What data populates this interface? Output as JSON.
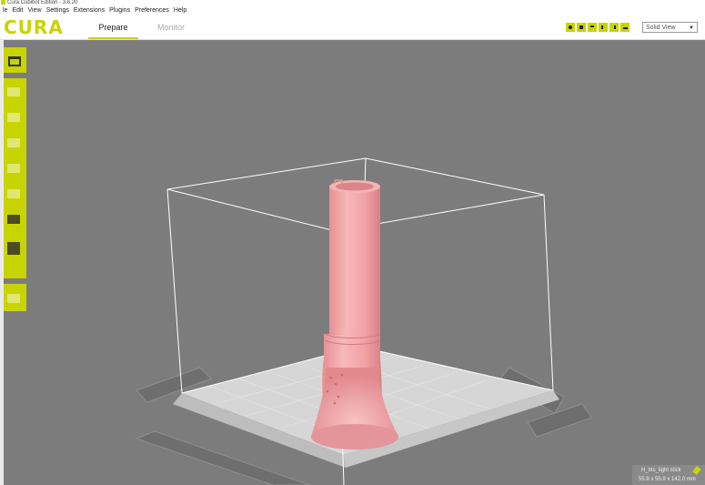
{
  "window": {
    "title": "Cura Cubibot Edition - 3.6.20"
  },
  "menu": [
    "le",
    "Edit",
    "View",
    "Settings",
    "Extensions",
    "Plugins",
    "Preferences",
    "Help"
  ],
  "app": {
    "logo": "CURA"
  },
  "stages": {
    "prepare": "Prepare",
    "monitor": "Monitor"
  },
  "view_buttons": [
    "3d-view-icon",
    "front-view-icon",
    "top-view-icon",
    "left-view-icon",
    "right-view-icon",
    "layer-view-icon"
  ],
  "view_mode": {
    "selected": "Solid View",
    "arrow": "▼"
  },
  "left_toolbar": [
    "open-file-icon",
    "move-icon",
    "scale-icon",
    "rotate-icon",
    "mirror-icon",
    "per-model-settings-icon",
    "support-blocker-icon",
    "support-icon",
    "arrange-icon"
  ],
  "object": {
    "name": "H_bts_light stick",
    "dimensions": "55.9 x 55.9 x 142.0 mm"
  },
  "colors": {
    "accent": "#c8d400",
    "model": "#f0a7a9",
    "viewport": "#7c7c7c",
    "build_plate": "#d4d4d4"
  }
}
